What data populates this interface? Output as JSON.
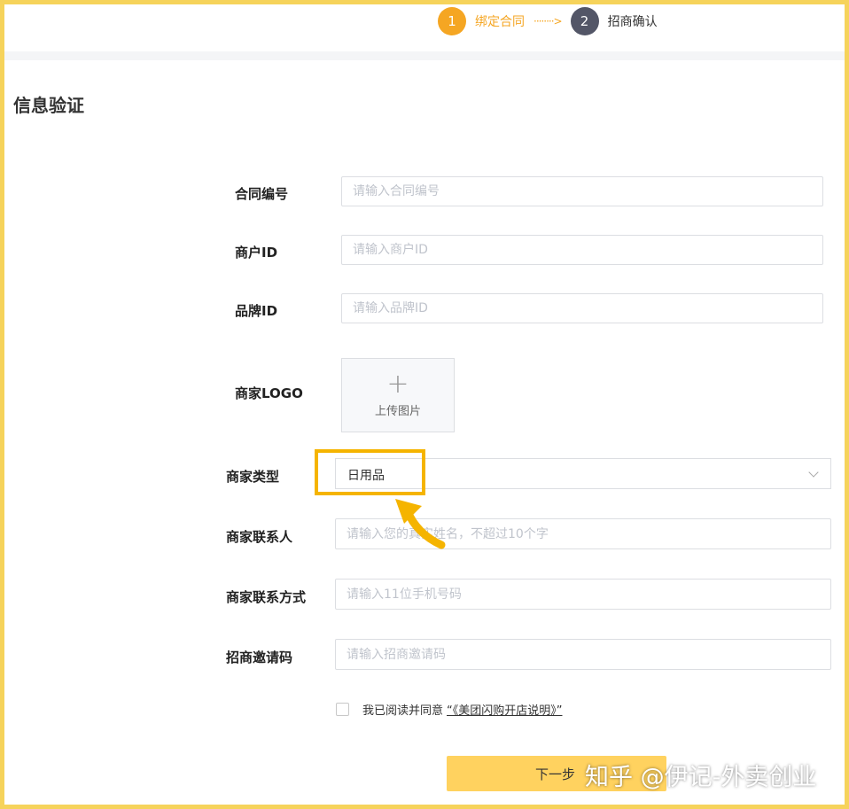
{
  "steps": [
    {
      "number": "1",
      "label": "绑定合同",
      "state": "active"
    },
    {
      "number": "2",
      "label": "招商确认",
      "state": "inactive"
    }
  ],
  "step_arrow": "········>",
  "section_title": "信息验证",
  "form": {
    "contract_no": {
      "label": "合同编号",
      "placeholder": "请输入合同编号"
    },
    "merchant_id": {
      "label": "商户ID",
      "placeholder": "请输入商户ID"
    },
    "brand_id": {
      "label": "品牌ID",
      "placeholder": "请输入品牌ID"
    },
    "logo": {
      "label": "商家LOGO",
      "upload_text": "上传图片",
      "plus": "+"
    },
    "merchant_type": {
      "label": "商家类型",
      "value": "日用品"
    },
    "contact_person": {
      "label": "商家联系人",
      "placeholder": "请输入您的真实姓名，不超过10个字"
    },
    "contact_phone": {
      "label": "商家联系方式",
      "placeholder": "请输入11位手机号码"
    },
    "invite_code": {
      "label": "招商邀请码",
      "placeholder": "请输入招商邀请码"
    }
  },
  "agreement": {
    "text": "我已阅读并同意",
    "link": "“《美团闪购开店说明》”",
    "checked": false
  },
  "next_button": "下一步",
  "watermark": "知乎 @伊记-外卖创业",
  "colors": {
    "accent": "#f5a623",
    "highlight": "#f5b400",
    "button": "#ffd25f",
    "frame": "#f6d35b",
    "inactive_step": "#535667"
  }
}
